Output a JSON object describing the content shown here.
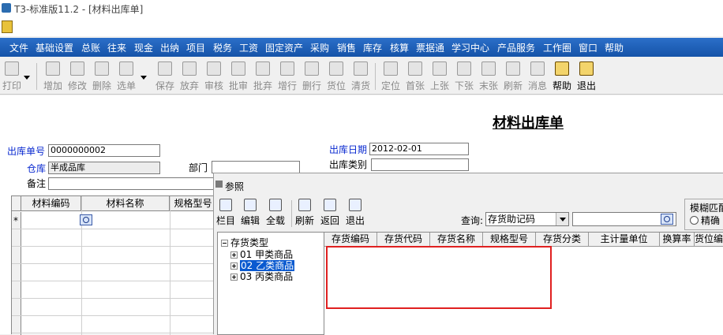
{
  "window": {
    "title": "T3-标准版11.2 - [材料出库单]"
  },
  "menu": [
    "文件",
    "基础设置",
    "总账",
    "往来",
    "现金",
    "出纳",
    "项目",
    "税务",
    "工资",
    "固定资产",
    "采购",
    "销售",
    "库存",
    "核算",
    "票据通",
    "学习中心",
    "产品服务",
    "工作圈",
    "窗口",
    "帮助"
  ],
  "toolbar": [
    "打印",
    "增加",
    "修改",
    "删除",
    "选单",
    "保存",
    "放弃",
    "审核",
    "批审",
    "批弃",
    "增行",
    "删行",
    "货位",
    "清货",
    "定位",
    "首张",
    "上张",
    "下张",
    "末张",
    "刷新",
    "消息",
    "帮助",
    "退出"
  ],
  "document": {
    "title": "材料出库单",
    "order_no_label": "出库单号",
    "order_no": "0000000002",
    "date_label": "出库日期",
    "date": "2012-02-01",
    "warehouse_label": "仓库",
    "warehouse": "半成品库",
    "department_label": "部门",
    "type_label": "出库类别",
    "remark_label": "备注",
    "grid_headers": [
      "材料编码",
      "材料名称",
      "规格型号"
    ],
    "new_row_marker": "*"
  },
  "dialog": {
    "title": "参照",
    "toolbar": [
      "栏目",
      "编辑",
      "全载",
      "刷新",
      "返回",
      "退出"
    ],
    "query_label": "查询:",
    "query_field": "存货助记码",
    "fuzzy_label": "模糊匹配",
    "exact_label": "精确",
    "tree": {
      "root": "存货类型",
      "items": [
        "01 甲类商品",
        "02 乙类商品",
        "03 丙类商品"
      ],
      "selected_index": 1
    },
    "columns": [
      "存货编码",
      "存货代码",
      "存货名称",
      "规格型号",
      "存货分类",
      "主计量单位",
      "换算率",
      "货位编"
    ]
  },
  "colors": {
    "menubar": "#1d5fb8",
    "selection": "#0a5ad0",
    "highlight_box": "#e02020",
    "label_blue": "#0a2ad0"
  }
}
